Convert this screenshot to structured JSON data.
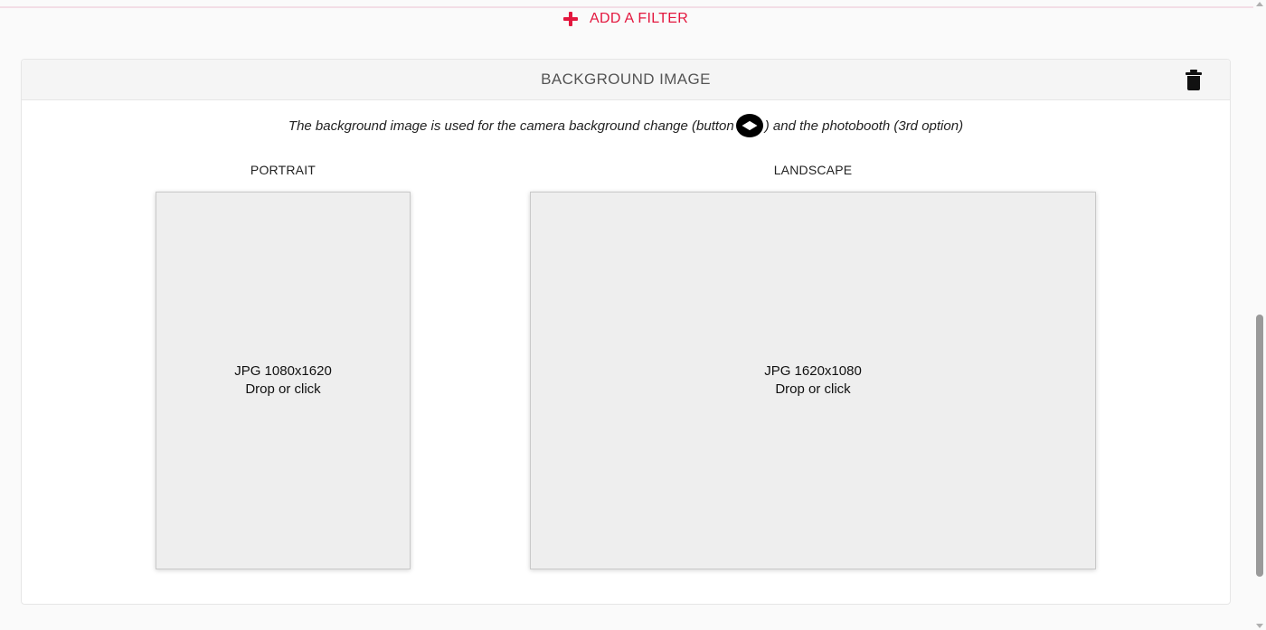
{
  "filters": {
    "add_label": "ADD A FILTER",
    "add_icon": "plus-icon"
  },
  "background_panel": {
    "title": "BACKGROUND IMAGE",
    "delete_icon": "trash-icon",
    "description_before": "The background image is used for the camera background change (button",
    "description_icon": "layers-icon",
    "description_after": ") and the photobooth (3rd option)",
    "portrait": {
      "label": "PORTRAIT",
      "format": "JPG 1080x1620",
      "hint": "Drop or click"
    },
    "landscape": {
      "label": "LANDSCAPE",
      "format": "JPG 1620x1080",
      "hint": "Drop or click"
    }
  },
  "colors": {
    "accent": "#e3173e",
    "dropzone_bg": "#eeeeee",
    "header_bg": "#f5f5f5"
  }
}
